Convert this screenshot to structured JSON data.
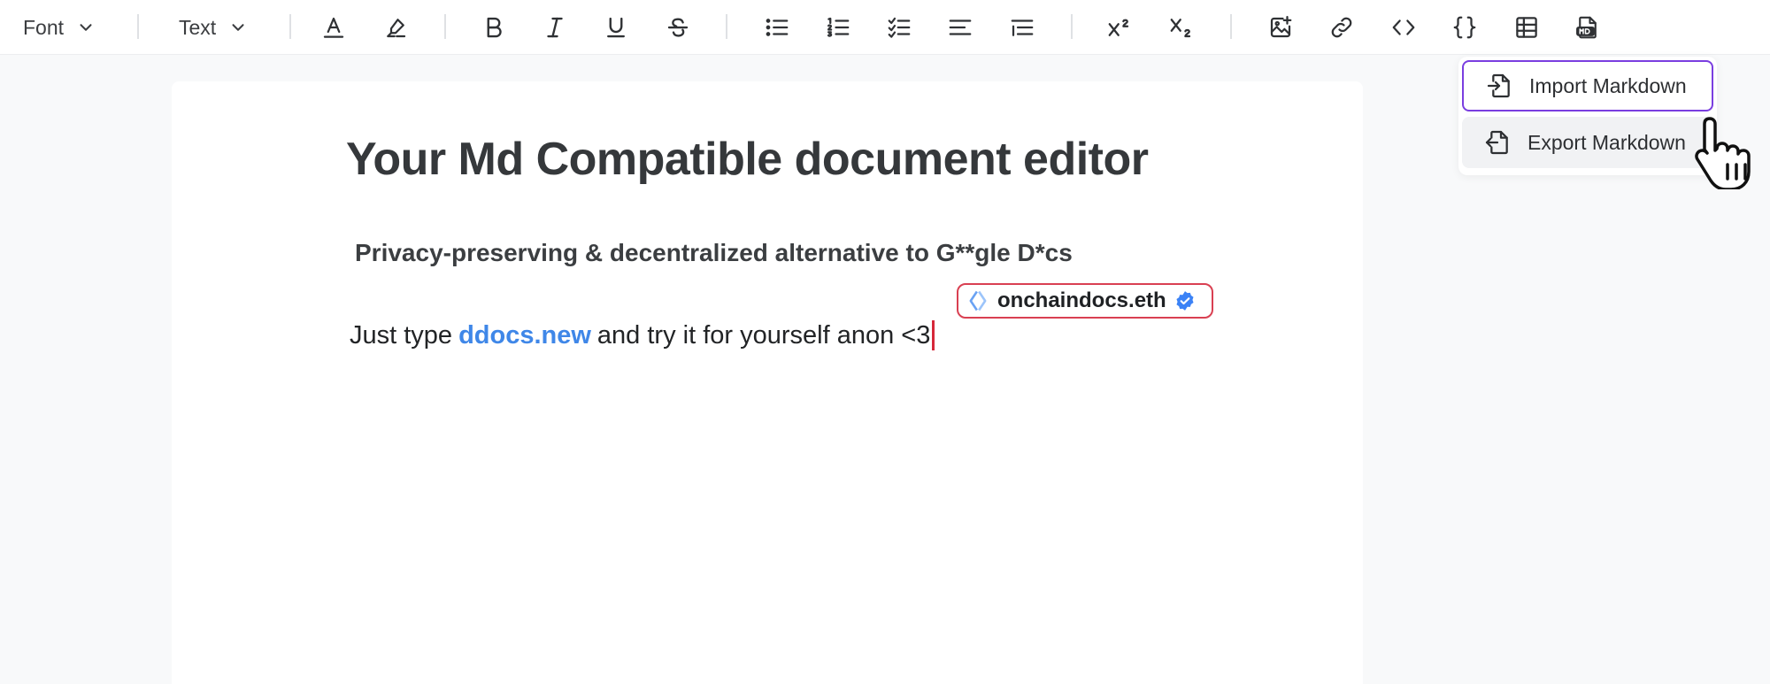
{
  "toolbar": {
    "font_label": "Font",
    "text_label": "Text"
  },
  "document": {
    "title": "Your Md Compatible document editor",
    "subtitle": "Privacy-preserving & decentralized alternative to G**gle D*cs",
    "line_prefix": "Just type",
    "line_link": "ddocs.new",
    "line_suffix": "and try it for yourself anon <3"
  },
  "collaborator": {
    "name": "onchaindocs.eth",
    "border_color": "#d94052"
  },
  "markdown_menu": {
    "import_label": "Import Markdown",
    "export_label": "Export Markdown",
    "highlight_color": "#7a3ee0"
  },
  "colors": {
    "link": "#3f87e8",
    "caret": "#d6283a",
    "verified_badge": "#3b82f6"
  }
}
